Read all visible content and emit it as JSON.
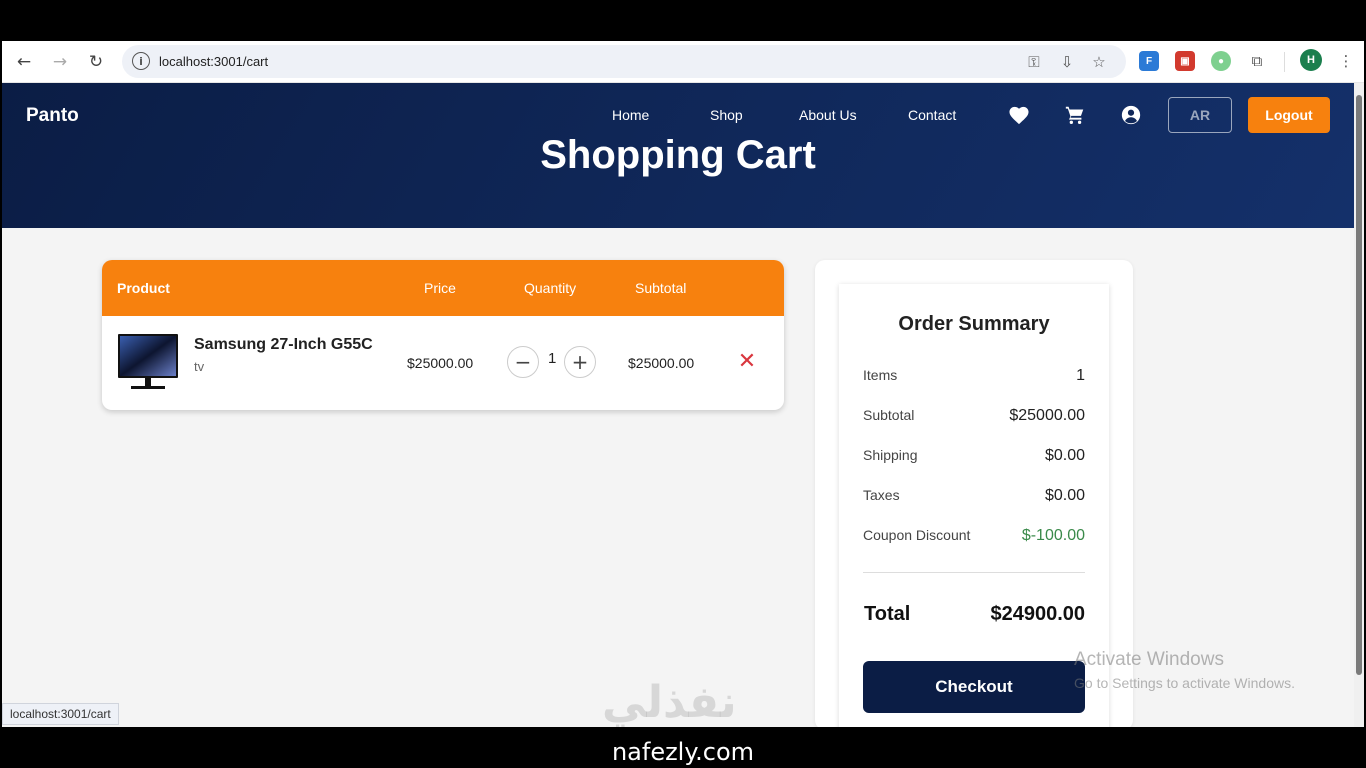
{
  "browser": {
    "url": "localhost:3001/cart",
    "status_url": "localhost:3001/cart",
    "profile_initial": "H"
  },
  "navbar": {
    "brand": "Panto",
    "links": [
      "Home",
      "Shop",
      "About Us",
      "Contact"
    ],
    "lang_button": "AR",
    "logout_button": "Logout"
  },
  "page": {
    "title": "Shopping Cart"
  },
  "cart": {
    "columns": {
      "product": "Product",
      "price": "Price",
      "quantity": "Quantity",
      "subtotal": "Subtotal"
    },
    "items": [
      {
        "name": "Samsung 27-Inch G55C",
        "category": "tv",
        "price": "$25000.00",
        "quantity": "1",
        "subtotal": "$25000.00"
      }
    ]
  },
  "summary": {
    "title": "Order Summary",
    "rows": [
      {
        "label": "Items",
        "value": "1"
      },
      {
        "label": "Subtotal",
        "value": "$25000.00"
      },
      {
        "label": "Shipping",
        "value": "$0.00"
      },
      {
        "label": "Taxes",
        "value": "$0.00"
      },
      {
        "label": "Coupon Discount",
        "value": "$-100.00"
      }
    ],
    "total_label": "Total",
    "total_value": "$24900.00",
    "checkout_label": "Checkout"
  },
  "overlay": {
    "windows_line1": "Activate Windows",
    "windows_line2": "Go to Settings to activate Windows.",
    "site_watermark": "نفذلي",
    "footer_brand": "nafezly.com"
  },
  "colors": {
    "accent": "#f7810e",
    "navy": "#0b1d45",
    "discount": "#3a8a4a",
    "remove": "#d9363e"
  }
}
